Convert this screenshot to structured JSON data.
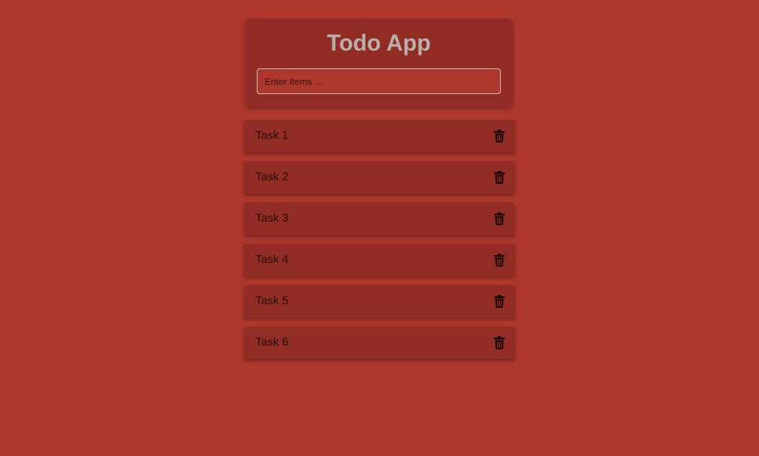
{
  "header": {
    "title": "Todo App"
  },
  "input": {
    "placeholder": "Enter Items ...",
    "value": ""
  },
  "tasks": [
    {
      "label": "Task 1",
      "delete_icon": "trash-icon"
    },
    {
      "label": "Task 2",
      "delete_icon": "trash-icon"
    },
    {
      "label": "Task 3",
      "delete_icon": "trash-icon"
    },
    {
      "label": "Task 4",
      "delete_icon": "trash-icon"
    },
    {
      "label": "Task 5",
      "delete_icon": "trash-icon"
    },
    {
      "label": "Task 6",
      "delete_icon": "trash-icon"
    }
  ],
  "colors": {
    "background": "#ae372d",
    "card": "#912d25",
    "title": "#b9aeac",
    "text": "#2a0c09"
  }
}
